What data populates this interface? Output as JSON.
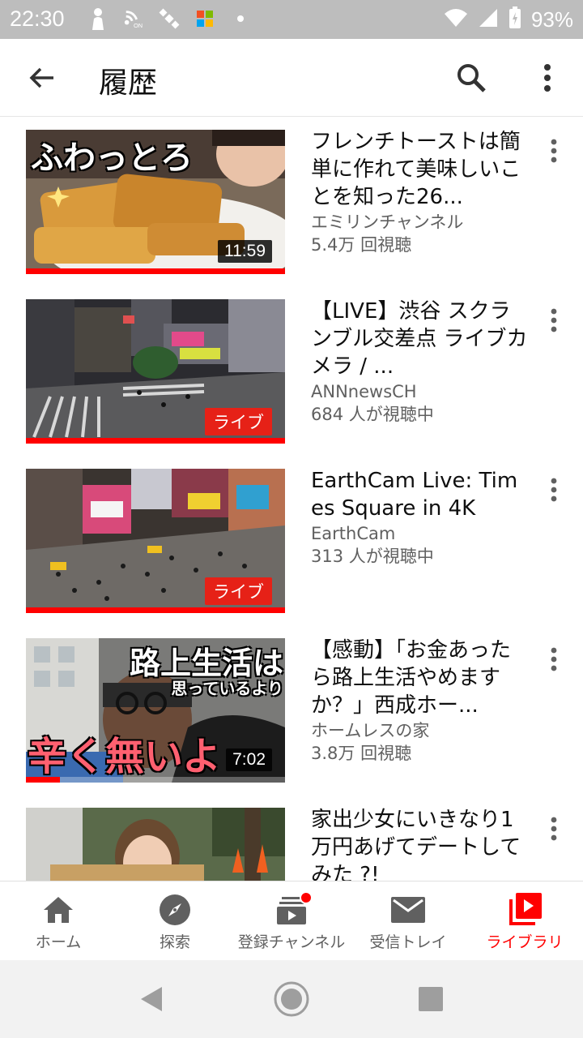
{
  "status_bar": {
    "time": "22:30",
    "battery": "93%",
    "icons": [
      "person-icon",
      "nfc-icon",
      "satellite-icon",
      "app-icon",
      "wifi-icon",
      "signal-icon",
      "battery-icon"
    ]
  },
  "app_bar": {
    "title": "履歴",
    "icons": [
      "back-arrow-icon",
      "search-icon",
      "more-vert-icon"
    ]
  },
  "videos": [
    {
      "title": "フレンチトーストは簡単に作れて美味しいことを知った26...",
      "channel": "エミリンチャンネル",
      "stats": "5.4万 回視聴",
      "duration": "11:59",
      "overlay": "ふわっとろ",
      "progress": 1.0
    },
    {
      "title": "【LIVE】渋谷 スクランブル交差点 ライブカメラ / ...",
      "channel": "ANNnewsCH",
      "stats": "684 人が視聴中",
      "badge": "ライブ",
      "progress": 1.0
    },
    {
      "title": "EarthCam Live: Times Square in 4K",
      "channel": "EarthCam",
      "stats": "313 人が視聴中",
      "badge": "ライブ",
      "progress": 1.0
    },
    {
      "title": "【感動】「お金あったら路上生活やめますか？」西成ホー...",
      "channel": "ホームレスの家",
      "stats": "3.8万 回視聴",
      "duration": "7:02",
      "overlay_top": "路上生活は",
      "overlay_mid": "思っているより",
      "overlay_bottom": "辛く無いよ",
      "progress": 0.13
    },
    {
      "title": "家出少女にいきなり1万円あげてデートしてみた ?!",
      "channel": "",
      "stats": ""
    }
  ],
  "bottom_nav": {
    "tabs": [
      {
        "label": "ホーム",
        "icon": "home-icon"
      },
      {
        "label": "探索",
        "icon": "explore-icon"
      },
      {
        "label": "登録チャンネル",
        "icon": "subscriptions-icon"
      },
      {
        "label": "受信トレイ",
        "icon": "inbox-icon"
      },
      {
        "label": "ライブラリ",
        "icon": "library-icon"
      }
    ],
    "active_tab": "ライブラリ",
    "accent_color": "#ff0000"
  },
  "system_nav": {
    "icons": [
      "back-triangle-icon",
      "home-circle-icon",
      "recents-square-icon"
    ]
  }
}
